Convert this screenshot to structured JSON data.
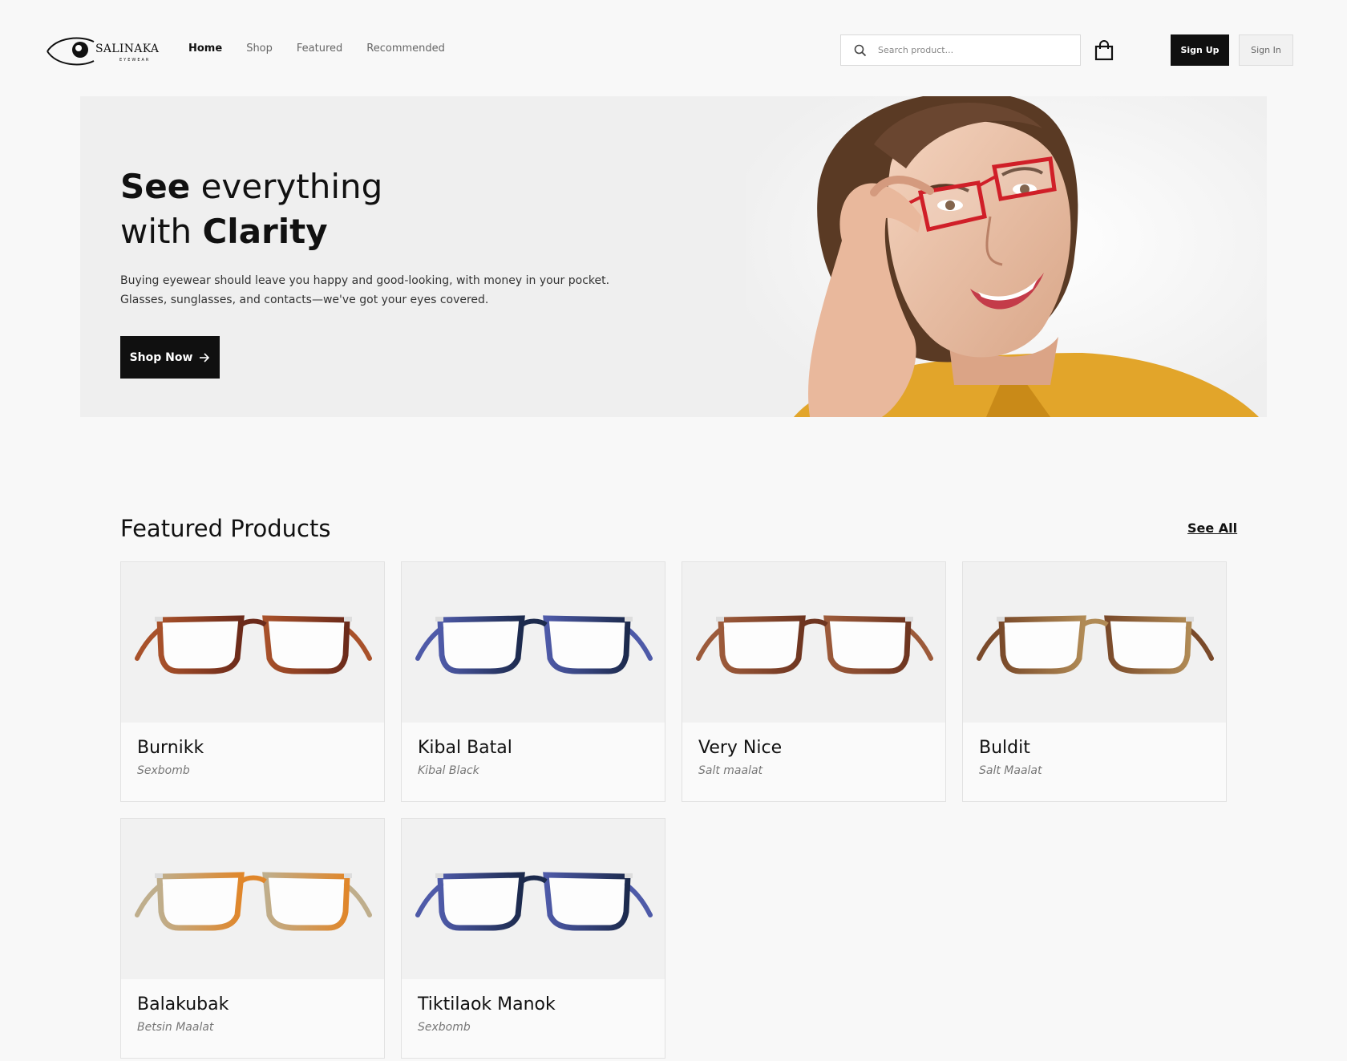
{
  "logo": {
    "name": "SALINAKA",
    "sub": "EYEWEAR"
  },
  "nav": {
    "links": [
      {
        "label": "Home",
        "active": true
      },
      {
        "label": "Shop",
        "active": false
      },
      {
        "label": "Featured",
        "active": false
      },
      {
        "label": "Recommended",
        "active": false
      }
    ],
    "search_placeholder": "Search product...",
    "cart_icon": "shopping-bag-icon",
    "signup_label": "Sign Up",
    "signin_label": "Sign In"
  },
  "hero": {
    "title_line1_bold": "See",
    "title_line1_rest": " everything",
    "title_line2_rest": "with ",
    "title_line2_bold": "Clarity",
    "description": "Buying eyewear should leave you happy and good-looking, with money in your pocket. Glasses, sunglasses, and contacts—we've got your eyes covered.",
    "cta_label": "Shop Now",
    "cta_icon": "arrow-right-icon"
  },
  "featured": {
    "title": "Featured Products",
    "see_all": "See All",
    "products": [
      {
        "name": "Burnikk",
        "brand": "Sexbomb",
        "frame_color": "#6b2a1a",
        "accent_color": "#a8512a"
      },
      {
        "name": "Kibal Batal",
        "brand": "Kibal Black",
        "frame_color": "#1c2a4d",
        "accent_color": "#4e5aa8"
      },
      {
        "name": "Very Nice",
        "brand": "Salt maalat",
        "frame_color": "#6e3520",
        "accent_color": "#9c5a3a"
      },
      {
        "name": "Buldit",
        "brand": "Salt Maalat",
        "frame_color": "#b08a55",
        "accent_color": "#7a4a2a"
      },
      {
        "name": "Balakubak",
        "brand": "Betsin Maalat",
        "frame_color": "#e0862a",
        "accent_color": "#bfae8c"
      },
      {
        "name": "Tiktilaok Manok",
        "brand": "Sexbomb",
        "frame_color": "#1c2a4d",
        "accent_color": "#4e5aa8"
      }
    ]
  },
  "colors": {
    "primary_button": "#101010",
    "page_bg": "#f8f8f8",
    "hero_bg": "#efefef"
  }
}
